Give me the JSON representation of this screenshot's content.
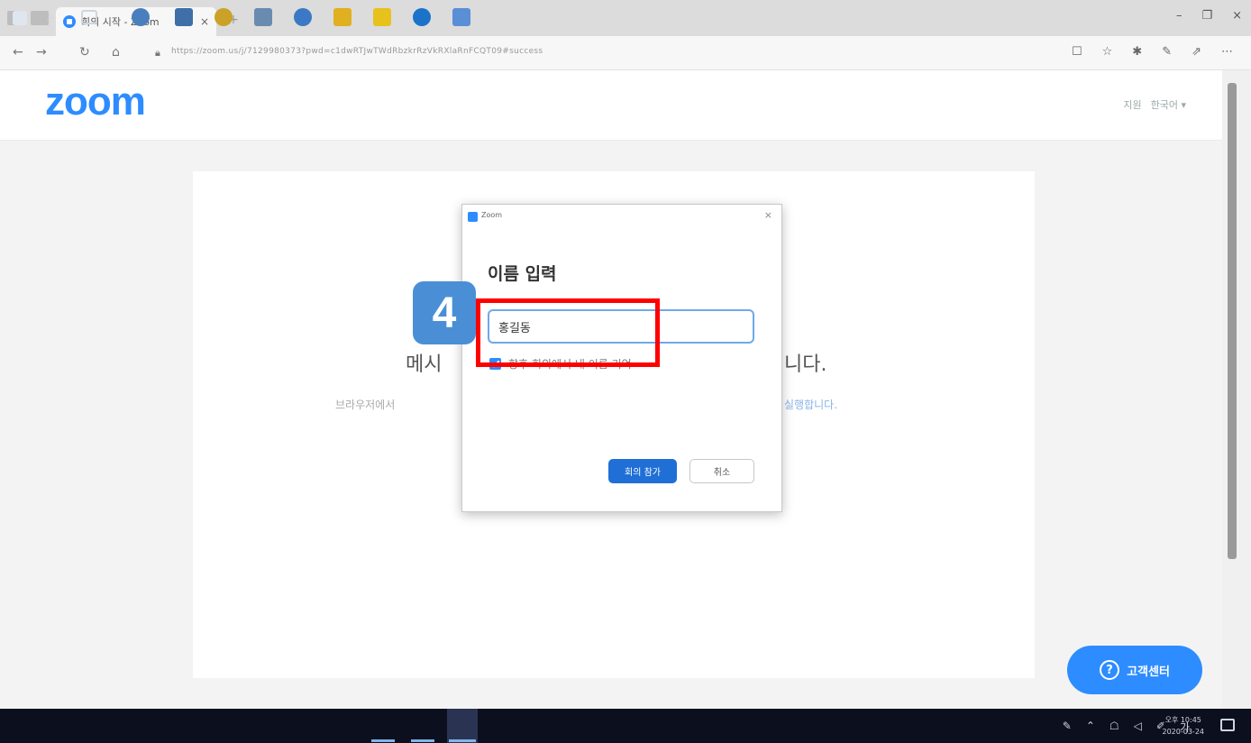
{
  "browser": {
    "tab_title": "회의 시작 - Zoom",
    "tab_close": "×",
    "new_tab": "+",
    "url": "https://zoom.us/j/7129980373?pwd=c1dwRTJwTWdRbzkrRzVkRXlaRnFCQT09#success",
    "win_minimize": "–",
    "win_maximize": "❐",
    "win_close": "×",
    "nav_back": "←",
    "nav_forward": "→",
    "nav_refresh": "↻",
    "nav_home": "⌂"
  },
  "page": {
    "logo": "zoom",
    "header_link_support": "지원",
    "header_link_language": "한국어 ▾",
    "bg_heading_left": "메시",
    "bg_heading_right": "니다.",
    "bg_sub_left": "브라우저에서",
    "bg_sub_right": "실행합니다."
  },
  "dialog": {
    "app_name": "Zoom",
    "close": "×",
    "heading": "이름 입력",
    "name_value": "홍길동",
    "remember_label": "향후 회의에서 내 이름 기억",
    "join_label": "회의 참가",
    "cancel_label": "취소"
  },
  "annotation": {
    "step_number": "4"
  },
  "help": {
    "icon": "?",
    "label": "고객센터"
  },
  "taskbar": {
    "search_icon": "⌕",
    "time": "오후 10:45",
    "date": "2020-03-24"
  },
  "colors": {
    "brand": "#2d8cff",
    "highlight": "#ff0000",
    "taskbar": "#0c0f1e"
  }
}
